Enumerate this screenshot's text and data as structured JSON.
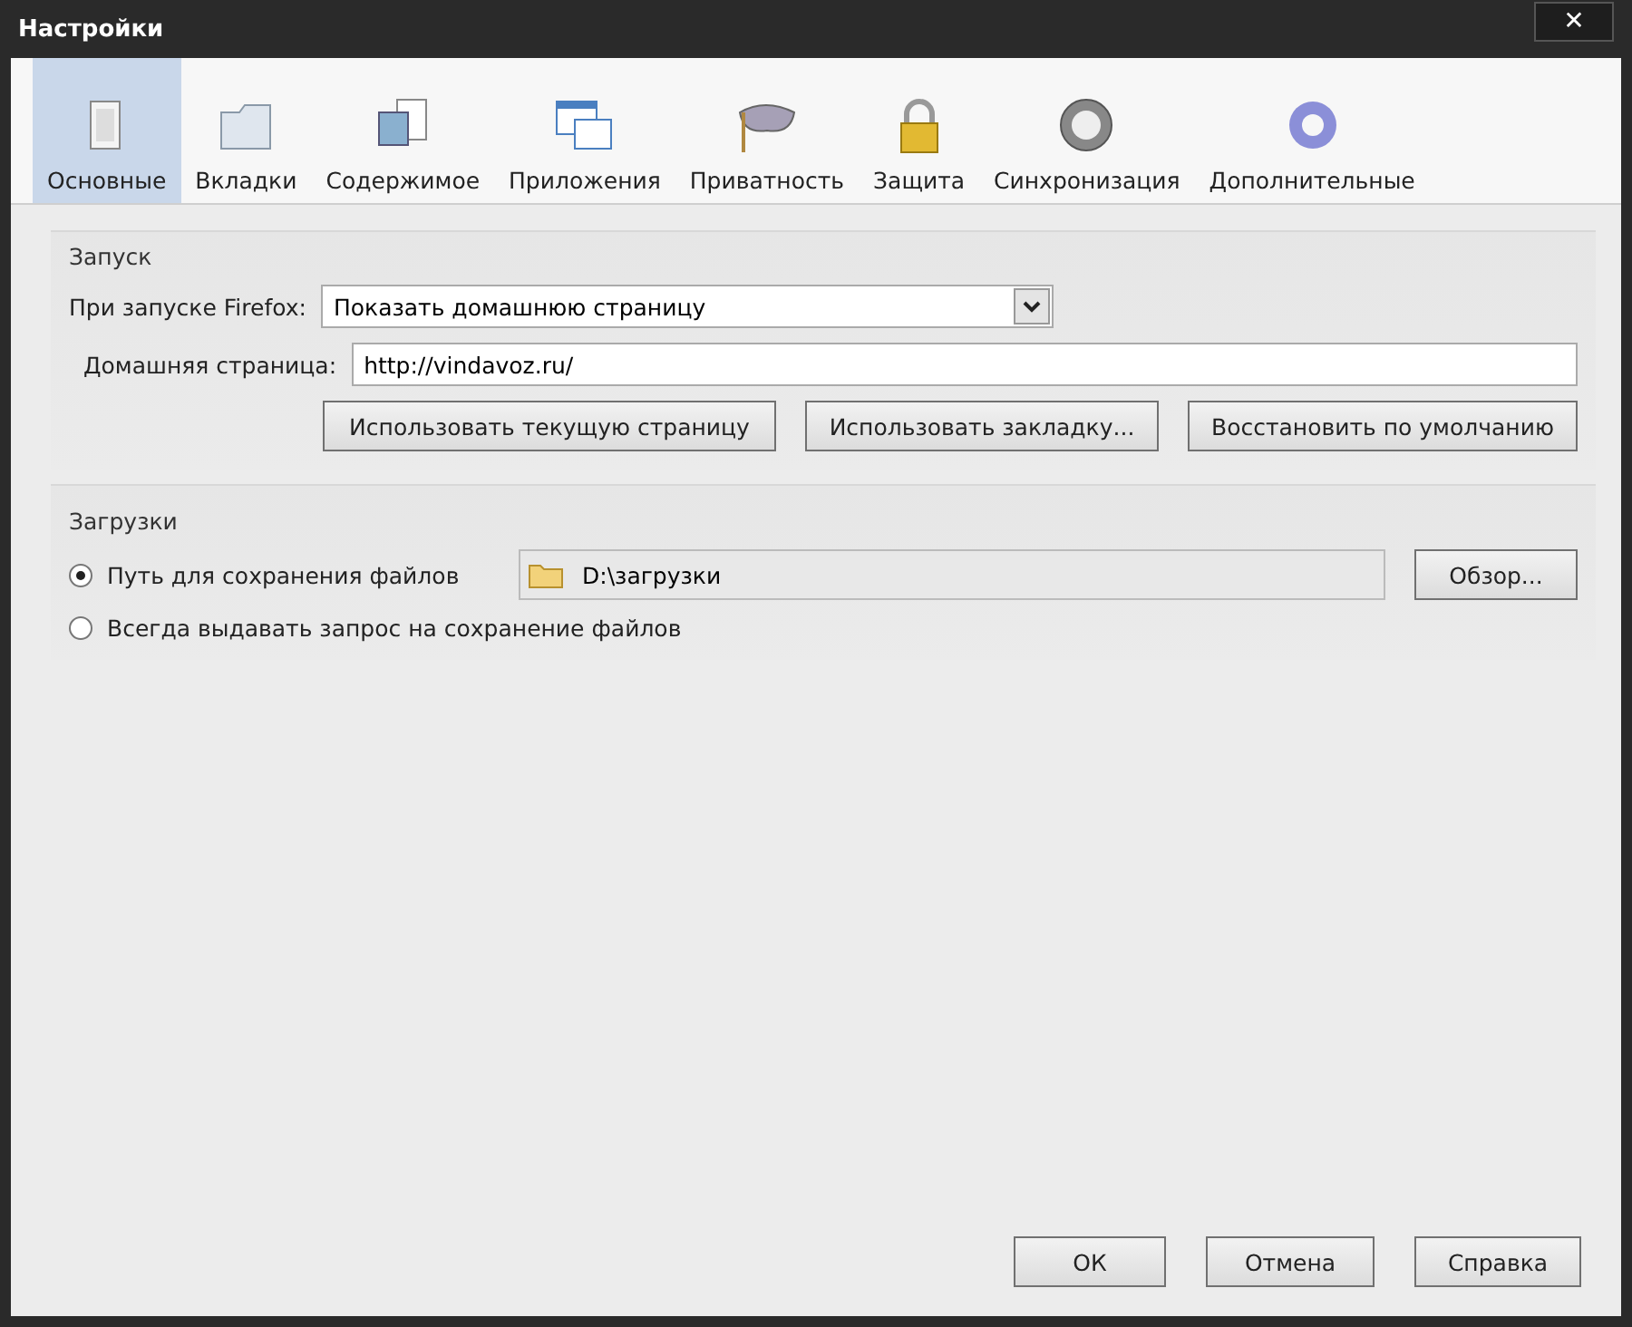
{
  "window": {
    "title": "Настройки",
    "close": "✕"
  },
  "tabs": [
    {
      "label": "Основные",
      "selected": true
    },
    {
      "label": "Вкладки",
      "selected": false
    },
    {
      "label": "Содержимое",
      "selected": false
    },
    {
      "label": "Приложения",
      "selected": false
    },
    {
      "label": "Приватность",
      "selected": false
    },
    {
      "label": "Защита",
      "selected": false
    },
    {
      "label": "Синхронизация",
      "selected": false
    },
    {
      "label": "Дополнительные",
      "selected": false
    }
  ],
  "startup": {
    "title": "Запуск",
    "on_start_label": "При запуске Firefox:",
    "on_start_value": "Показать домашнюю страницу",
    "home_label": "Домашняя страница:",
    "home_value": "http://vindavoz.ru/",
    "buttons": [
      "Использовать текущую страницу",
      "Использовать закладку...",
      "Восстановить по умолчанию"
    ]
  },
  "downloads": {
    "title": "Загрузки",
    "options": [
      {
        "label": "Путь для сохранения файлов",
        "selected": true
      },
      {
        "label": "Всегда выдавать запрос на сохранение файлов",
        "selected": false
      }
    ],
    "path": "D:\\загрузки",
    "browse": "Обзор..."
  },
  "footer_buttons": [
    "ОК",
    "Отмена",
    "Справка"
  ]
}
